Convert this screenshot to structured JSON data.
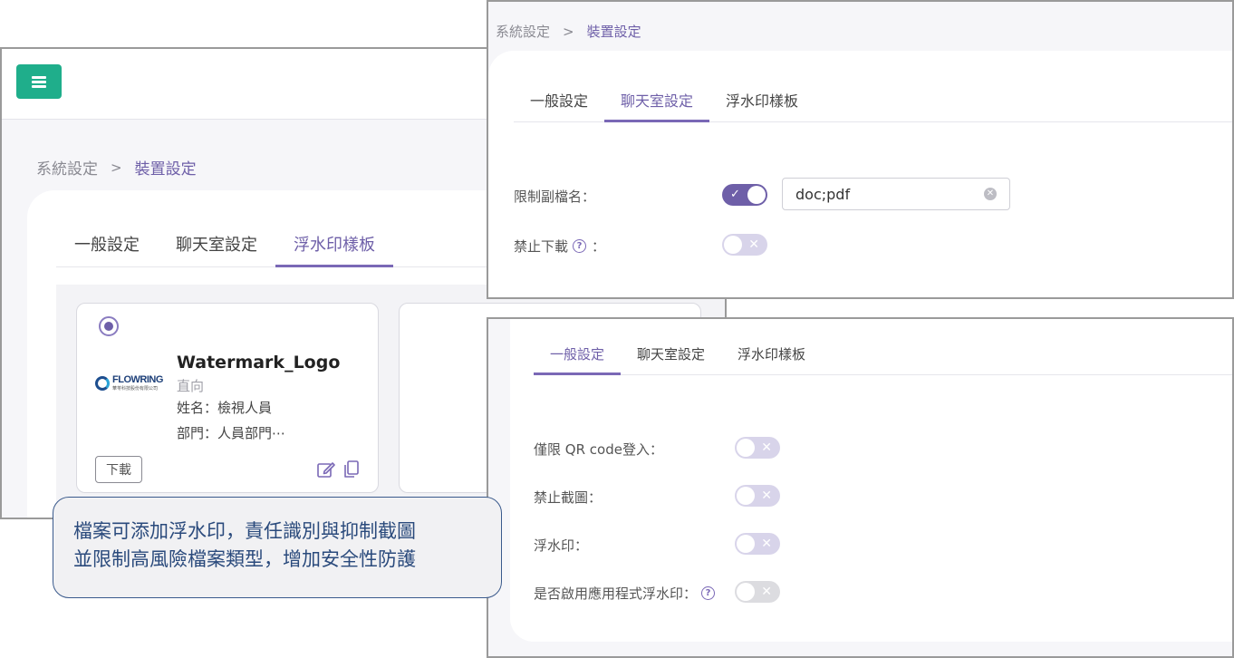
{
  "back_panel": {
    "breadcrumb": {
      "parent": "系統設定",
      "separator": ">",
      "current": "裝置設定"
    },
    "tabs": [
      "一般設定",
      "聊天室設定",
      "浮水印樣板"
    ],
    "active_tab": "浮水印樣板",
    "card": {
      "logo_name": "FLOWRING",
      "logo_sub": "華苓科技股份有限公司",
      "title": "Watermark_Logo",
      "orientation": "直向",
      "name_line": "姓名：檢視人員",
      "dept_line": "部門：人員部門⋯",
      "download_label": "下載",
      "edit_icon": "edit-icon",
      "copy_icon": "copy-icon"
    }
  },
  "caption": {
    "line1": "檔案可添加浮水印，責任識別與抑制截圖",
    "line2": "並限制高風險檔案類型，增加安全性防護"
  },
  "chat_panel": {
    "breadcrumb": {
      "parent": "系統設定",
      "separator": ">",
      "current": "裝置設定"
    },
    "tabs": [
      "一般設定",
      "聊天室設定",
      "浮水印樣板"
    ],
    "active_tab": "聊天室設定",
    "restrict_ext": {
      "label": "限制副檔名：",
      "enabled": true,
      "value": "doc;pdf"
    },
    "no_download": {
      "label": "禁止下載",
      "suffix": "：",
      "enabled": false
    }
  },
  "general_panel": {
    "tabs": [
      "一般設定",
      "聊天室設定",
      "浮水印樣板"
    ],
    "active_tab": "一般設定",
    "settings": [
      {
        "label": "僅限 QR code登入：",
        "enabled": false
      },
      {
        "label": "禁止截圖：",
        "enabled": false
      },
      {
        "label": "浮水印：",
        "enabled": false
      },
      {
        "label": "是否啟用應用程式浮水印：",
        "enabled": false
      }
    ]
  },
  "colors": {
    "accent": "#6e5fa8",
    "menu_button": "#1fae8b",
    "toggle_off": "#d8d4ea",
    "caption_text": "#2a4a7c"
  }
}
